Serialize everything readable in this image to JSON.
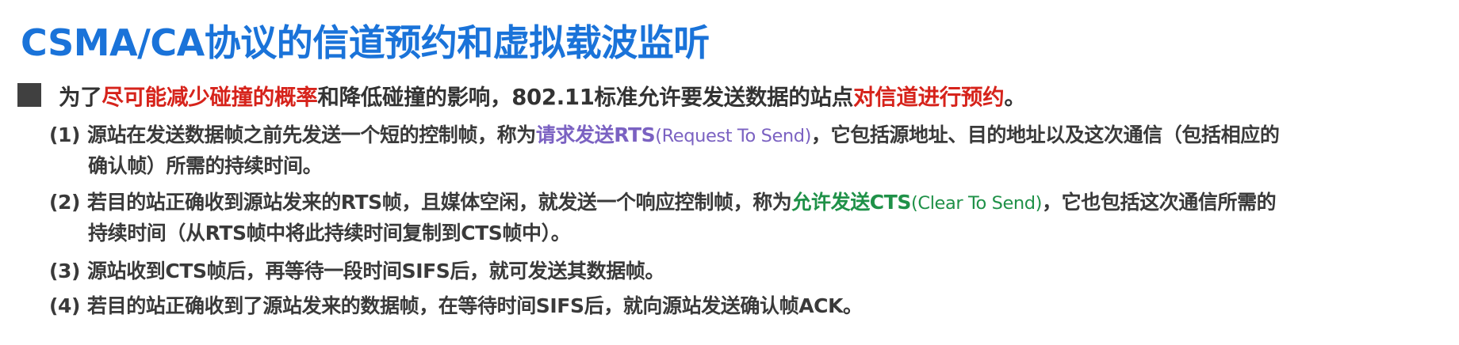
{
  "slide": {
    "title": "CSMA/CA协议的信道预约和虚拟载波监听",
    "bullet": {
      "pre": "为了",
      "highlight1": "尽可能减少碰撞的概率",
      "mid": "和降低碰撞的影响，802.11标准允许要发送数据的站点",
      "highlight2": "对信道进行预约",
      "end": "。"
    },
    "items": [
      {
        "num": "(1)",
        "pre": "源站在发送数据帧之前先发送一个短的控制帧，称为",
        "highlight": "请求发送RTS",
        "paren": "(Request To Send)",
        "post": "，它包括源地址、目的地址以及这次通信（包括相应的",
        "cont": "确认帧）所需的持续时间。"
      },
      {
        "num": "(2)",
        "pre": "若目的站正确收到源站发来的RTS帧，且媒体空闲，就发送一个响应控制帧，称为",
        "highlight": "允许发送CTS",
        "paren": "(Clear To Send)",
        "post": "，它也包括这次通信所需的",
        "cont": "持续时间（从RTS帧中将此持续时间复制到CTS帧中）。"
      },
      {
        "num": "(3)",
        "text": "源站收到CTS帧后，再等待一段时间SIFS后，就可发送其数据帧。"
      },
      {
        "num": "(4)",
        "text": "若目的站正确收到了源站发来的数据帧，在等待时间SIFS后，就向源站发送确认帧ACK。"
      }
    ],
    "colors": {
      "title": "#1a73d9",
      "emphasis_red": "#d6231b",
      "rts_purple": "#7b62c2",
      "cts_green": "#1f9148"
    }
  }
}
